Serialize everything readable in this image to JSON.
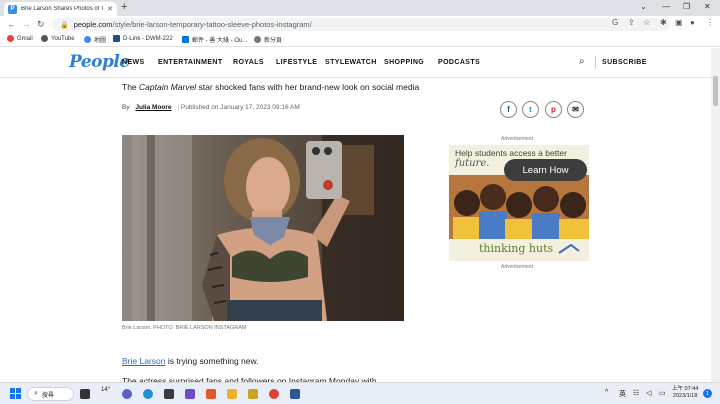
{
  "browser": {
    "tab_title": "Brie Larson Shares Photos of Te",
    "tab_favicon": "P",
    "url_domain": "people.com",
    "url_path": "/style/brie-larson-temporary-tattoo-sleeve-photos-instagram/",
    "bookmarks": [
      "Gmail",
      "YouTube",
      "地圖",
      "D-Link - DWM-222",
      "郵件 - 善 大綠 - Ou...",
      "新分頁"
    ]
  },
  "site": {
    "logo": "People",
    "nav": [
      "NEWS",
      "ENTERTAINMENT",
      "ROYALS",
      "LIFESTYLE",
      "STYLEWATCH",
      "SHOPPING",
      "PODCASTS"
    ],
    "subscribe": "SUBSCRIBE"
  },
  "article": {
    "subhead_pre": "The ",
    "subhead_italic": "Captain Marvel",
    "subhead_post": " star shocked fans with her brand-new look on social media",
    "by": "By",
    "author": "Julia Moore",
    "published": "Published on January 17, 2023 09:16 AM",
    "caption": "Brie Larson. PHOTO: BRIE LARSON INSTAGRAM",
    "body_link": "Brie Larson",
    "body_text": " is trying something new.",
    "body_text2": "The actress surprised fans and followers on Instagram Monday with"
  },
  "share": {
    "facebook": "f",
    "twitter": "t",
    "pinterest": "p",
    "email": "✉"
  },
  "ad": {
    "label_top": "Advertisement",
    "line1": "Help students access a better",
    "line2": "future.",
    "cta": "Learn How",
    "brand": "thinking huts",
    "label_bottom": "Advertisement"
  },
  "taskbar": {
    "search": "搜尋",
    "weather": "14°",
    "ime": "英",
    "time": "上午 07:44",
    "date": "2023/1/18",
    "notifications": "1"
  },
  "colors": {
    "brand_blue": "#2f7fd1",
    "link_blue": "#2f6fc1",
    "pinterest_red": "#c8232c"
  }
}
